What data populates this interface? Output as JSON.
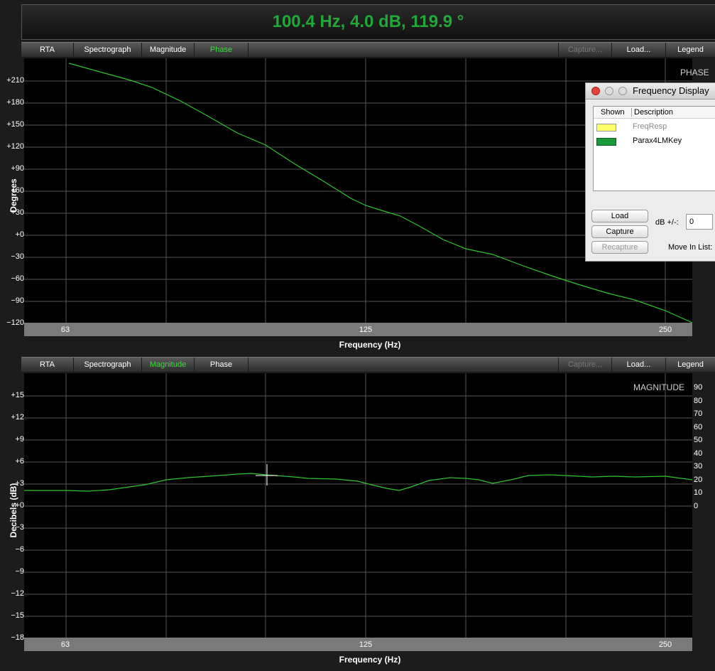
{
  "readout": "100.4 Hz, 4.0 dB, 119.9 °",
  "tabs_top": [
    {
      "label": "RTA",
      "state": "normal"
    },
    {
      "label": "Spectrograph",
      "state": "normal"
    },
    {
      "label": "Magnitude",
      "state": "normal"
    },
    {
      "label": "Phase",
      "state": "active"
    }
  ],
  "tabs_bottom": [
    {
      "label": "RTA",
      "state": "normal"
    },
    {
      "label": "Spectrograph",
      "state": "normal"
    },
    {
      "label": "Magnitude",
      "state": "active"
    },
    {
      "label": "Phase",
      "state": "normal"
    }
  ],
  "tab_actions": {
    "capture": "Capture...",
    "load": "Load...",
    "legend": "Legend"
  },
  "phase_plot": {
    "label": "PHASE",
    "ylabel": "Degrees",
    "xlabel": "Frequency (Hz)",
    "yticks": [
      "+210",
      "+180",
      "+150",
      "+120",
      "+90",
      "+60",
      "+30",
      "+0",
      "−30",
      "−60",
      "−90",
      "−120"
    ],
    "xticks": [
      "63",
      "125",
      "250"
    ]
  },
  "mag_plot": {
    "label": "MAGNITUDE",
    "ylabel": "Decibels (dB)",
    "xlabel": "Frequency (Hz)",
    "yticks": [
      "+15",
      "+12",
      "+9",
      "+6",
      "+3",
      "+0",
      "−3",
      "−6",
      "−9",
      "−12",
      "−15",
      "−18"
    ],
    "yticks_right": [
      "90",
      "80",
      "70",
      "60",
      "50",
      "40",
      "30",
      "20",
      "10",
      "0"
    ],
    "xticks": [
      "63",
      "125",
      "250"
    ]
  },
  "panel": {
    "title": "Frequency Display",
    "col_shown": "Shown",
    "col_desc": "Description",
    "items": [
      {
        "name": "FreqResp",
        "color": "#ffff66",
        "active": false
      },
      {
        "name": "Parax4LMKey",
        "color": "#1b9a3a",
        "active": true
      }
    ],
    "load": "Load",
    "capture": "Capture",
    "recapture": "Recapture",
    "db_label": "dB +/-:",
    "db_value": "0",
    "move_label": "Move In List:"
  },
  "colors": {
    "trace": "#2fc42f",
    "readout": "#22a838",
    "active_tab": "#3cdc3c"
  }
}
